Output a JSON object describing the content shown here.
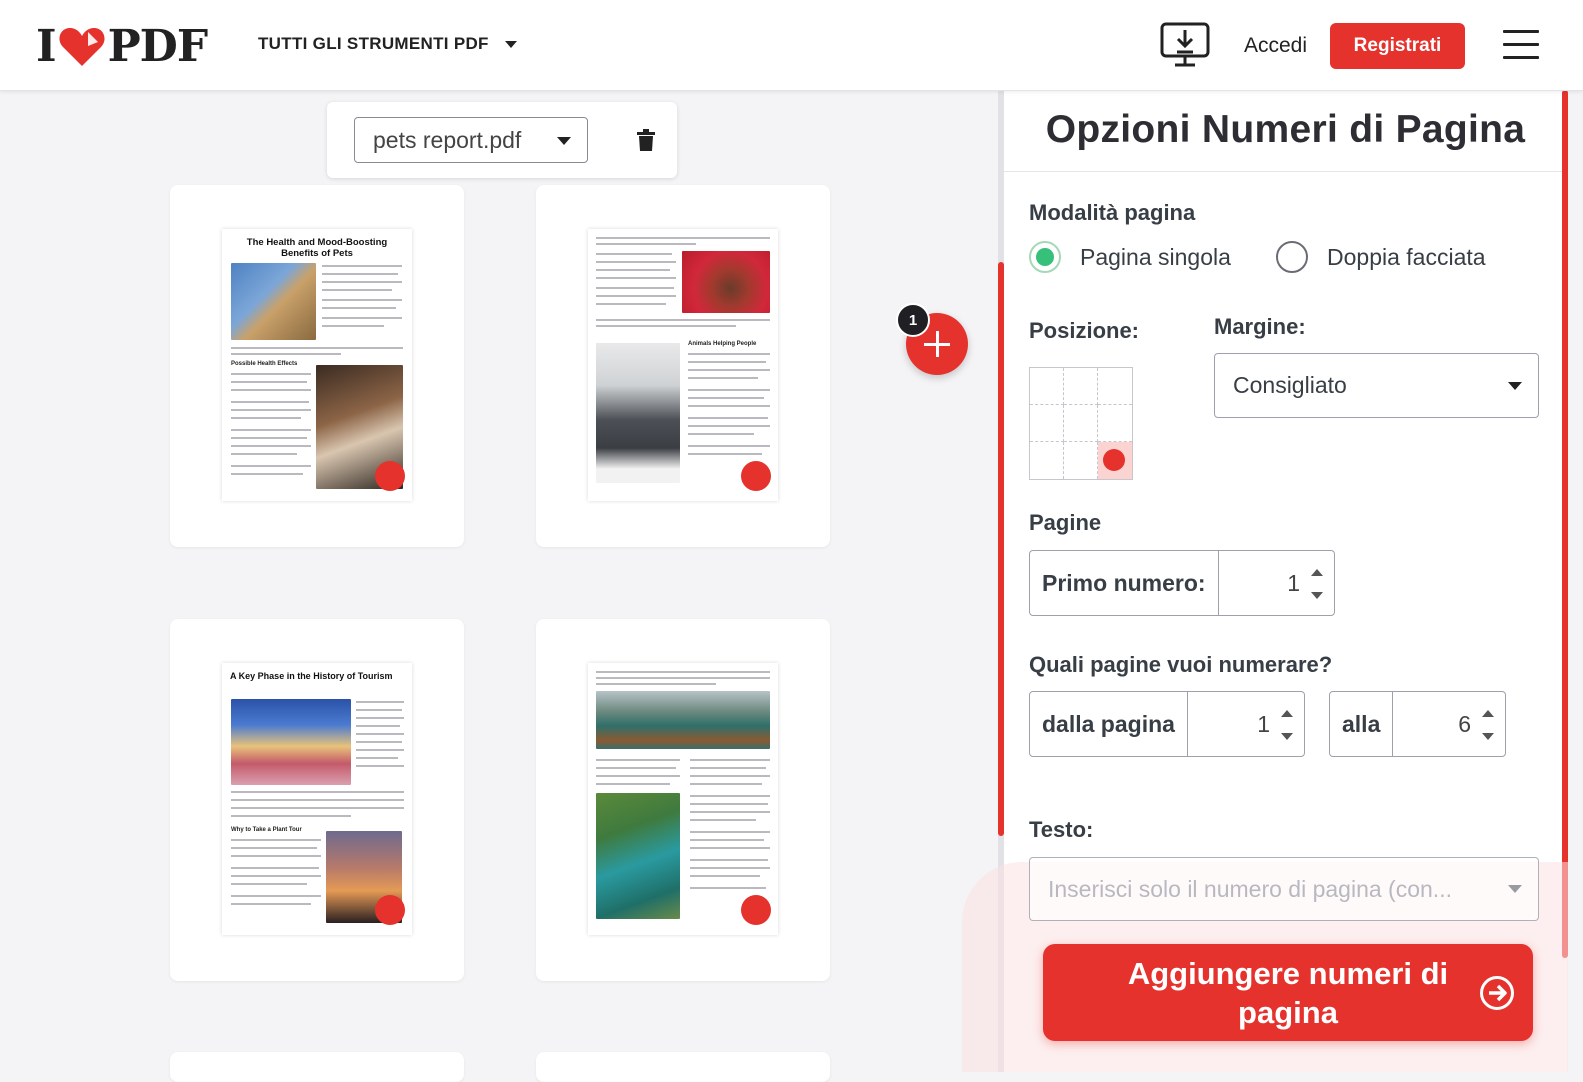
{
  "header": {
    "logo_left": "I",
    "logo_right": "PDF",
    "tools_menu_label": "TUTTI GLI STRUMENTI PDF",
    "login_label": "Accedi",
    "signup_label": "Registrati",
    "brand_color": "#e5322d",
    "icons": [
      "heart-logo-icon",
      "desktop-download-icon",
      "hamburger-menu-icon"
    ]
  },
  "workspace": {
    "file_select_value": "pets report.pdf",
    "pages": [
      {
        "title": "The Health and Mood-Boosting Benefits of Pets",
        "subheading": "Possible Health Effects"
      },
      {
        "title": "",
        "subheading": "Animals Helping People"
      },
      {
        "title": "A Key Phase in the History of Tourism",
        "subheading": "Why to Take a Plant Tour"
      },
      {
        "title": "",
        "subheading": ""
      }
    ],
    "add_files_count": "1"
  },
  "sidebar": {
    "title": "Opzioni Numeri di Pagina",
    "page_mode_label": "Modalità pagina",
    "page_mode_options": [
      "Pagina singola",
      "Doppia facciata"
    ],
    "page_mode_selected": "Pagina singola",
    "position_label": "Posizione:",
    "position_selected": "bottom-right",
    "margin_label": "Margine:",
    "margin_value": "Consigliato",
    "pages_label": "Pagine",
    "first_number_label": "Primo numero:",
    "first_number_value": "1",
    "which_pages_label": "Quali pagine vuoi numerare?",
    "from_label": "dalla pagina",
    "from_value": "1",
    "to_label": "alla",
    "to_value": "6",
    "text_label": "Testo:",
    "text_placeholder": "Inserisci solo il numero di pagina (con...",
    "submit_label": "Aggiungere numeri di pagina",
    "accent_green": "#36c07a"
  }
}
